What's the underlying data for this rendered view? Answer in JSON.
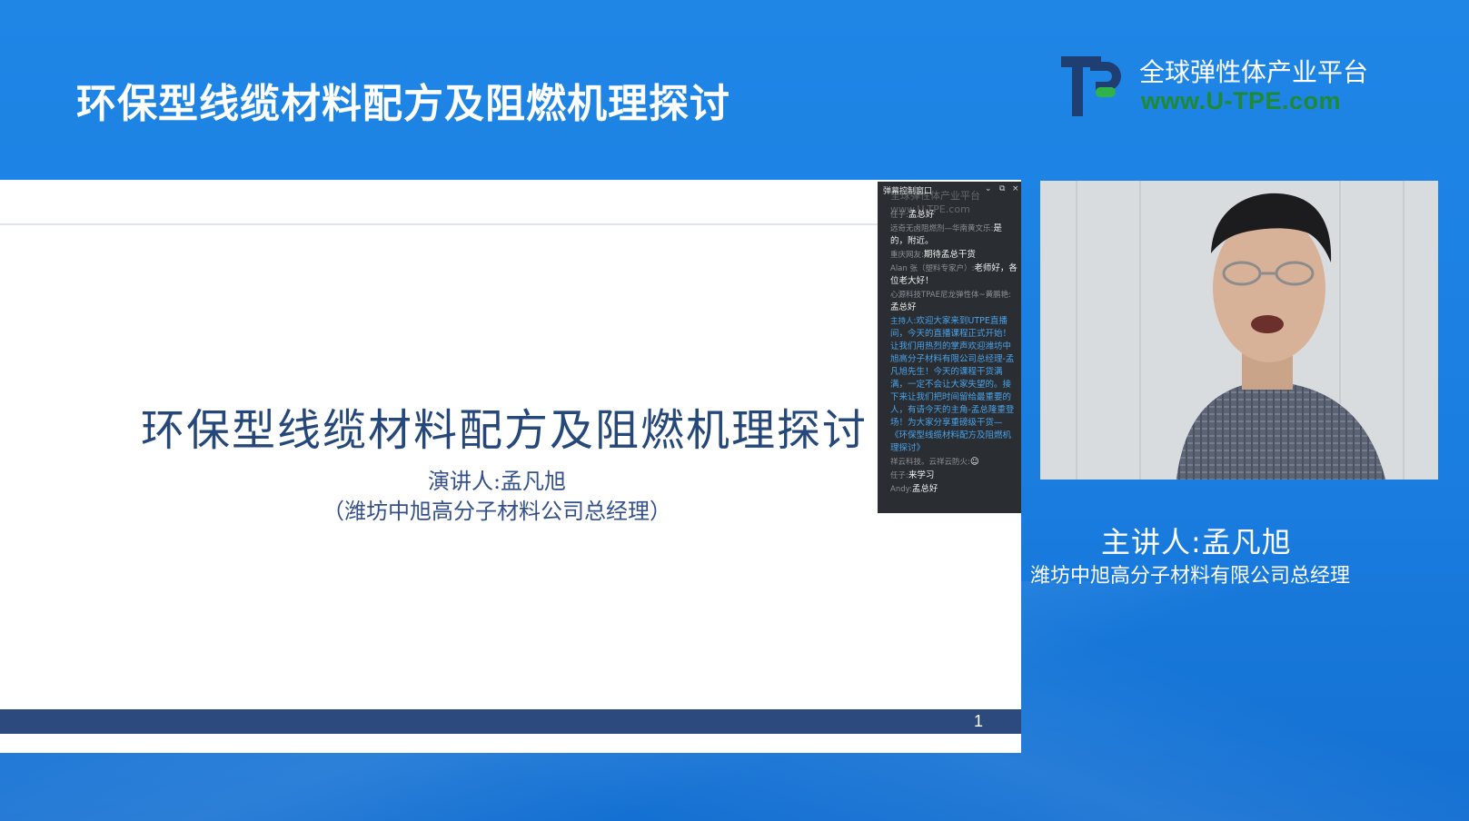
{
  "header": {
    "title": "环保型线缆材料配方及阻燃机理探讨",
    "brand_name": "全球弹性体产业平台",
    "brand_url": "www.U-TPE.com"
  },
  "slide": {
    "title": "环保型线缆材料配方及阻燃机理探讨",
    "presenter": "演讲人:孟凡旭",
    "company": "（潍坊中旭高分子材料公司总经理）",
    "page_number": "1"
  },
  "chat": {
    "window_title": "弹幕控制窗口",
    "watermark_line1": "全球弹性体产业平台",
    "watermark_line2": "www.U-TPE.com",
    "messages": [
      {
        "user": "任子:",
        "text": "孟总好",
        "host": false
      },
      {
        "user": "远奇无卤阻燃剂—华南黄文乐:",
        "text": "是的，附近。",
        "host": false
      },
      {
        "user": "重庆网友:",
        "text": "期待孟总干货",
        "host": false
      },
      {
        "user": "Alan 张（塑料专家户）:",
        "text": "老师好，各位老大好！",
        "host": false
      },
      {
        "user": "心源科技TPAE尼龙弹性体~黄鹏艳:",
        "text": "孟总好",
        "host": false
      },
      {
        "user": "主持人:",
        "text": "欢迎大家来到UTPE直播间，今天的直播课程正式开始！让我们用热烈的掌声欢迎潍坊中旭高分子材料有限公司总经理-孟凡旭先生！今天的课程干货满满，一定不会让大家失望的。接下来让我们把时间留给最重要的人，有请今天的主角-孟总隆重登场！为大家分享重磅级干货—《环保型线缆材料配方及阻燃机理探讨》",
        "host": true
      },
      {
        "user": "祥云科技。云祥云防火:",
        "text": "☺",
        "host": false
      },
      {
        "user": "任子:",
        "text": "来学习",
        "host": false
      },
      {
        "user": "Andy:",
        "text": "孟总好",
        "host": false
      }
    ]
  },
  "speaker": {
    "name": "主讲人:孟凡旭",
    "title": "潍坊中旭高分子材料有限公司总经理"
  },
  "colors": {
    "background": "#1f86e6",
    "slide_title": "#25477a",
    "slide_footer": "#2c4a7e",
    "brand_url": "#1e8a35",
    "chat_host": "#4aa3ea"
  }
}
